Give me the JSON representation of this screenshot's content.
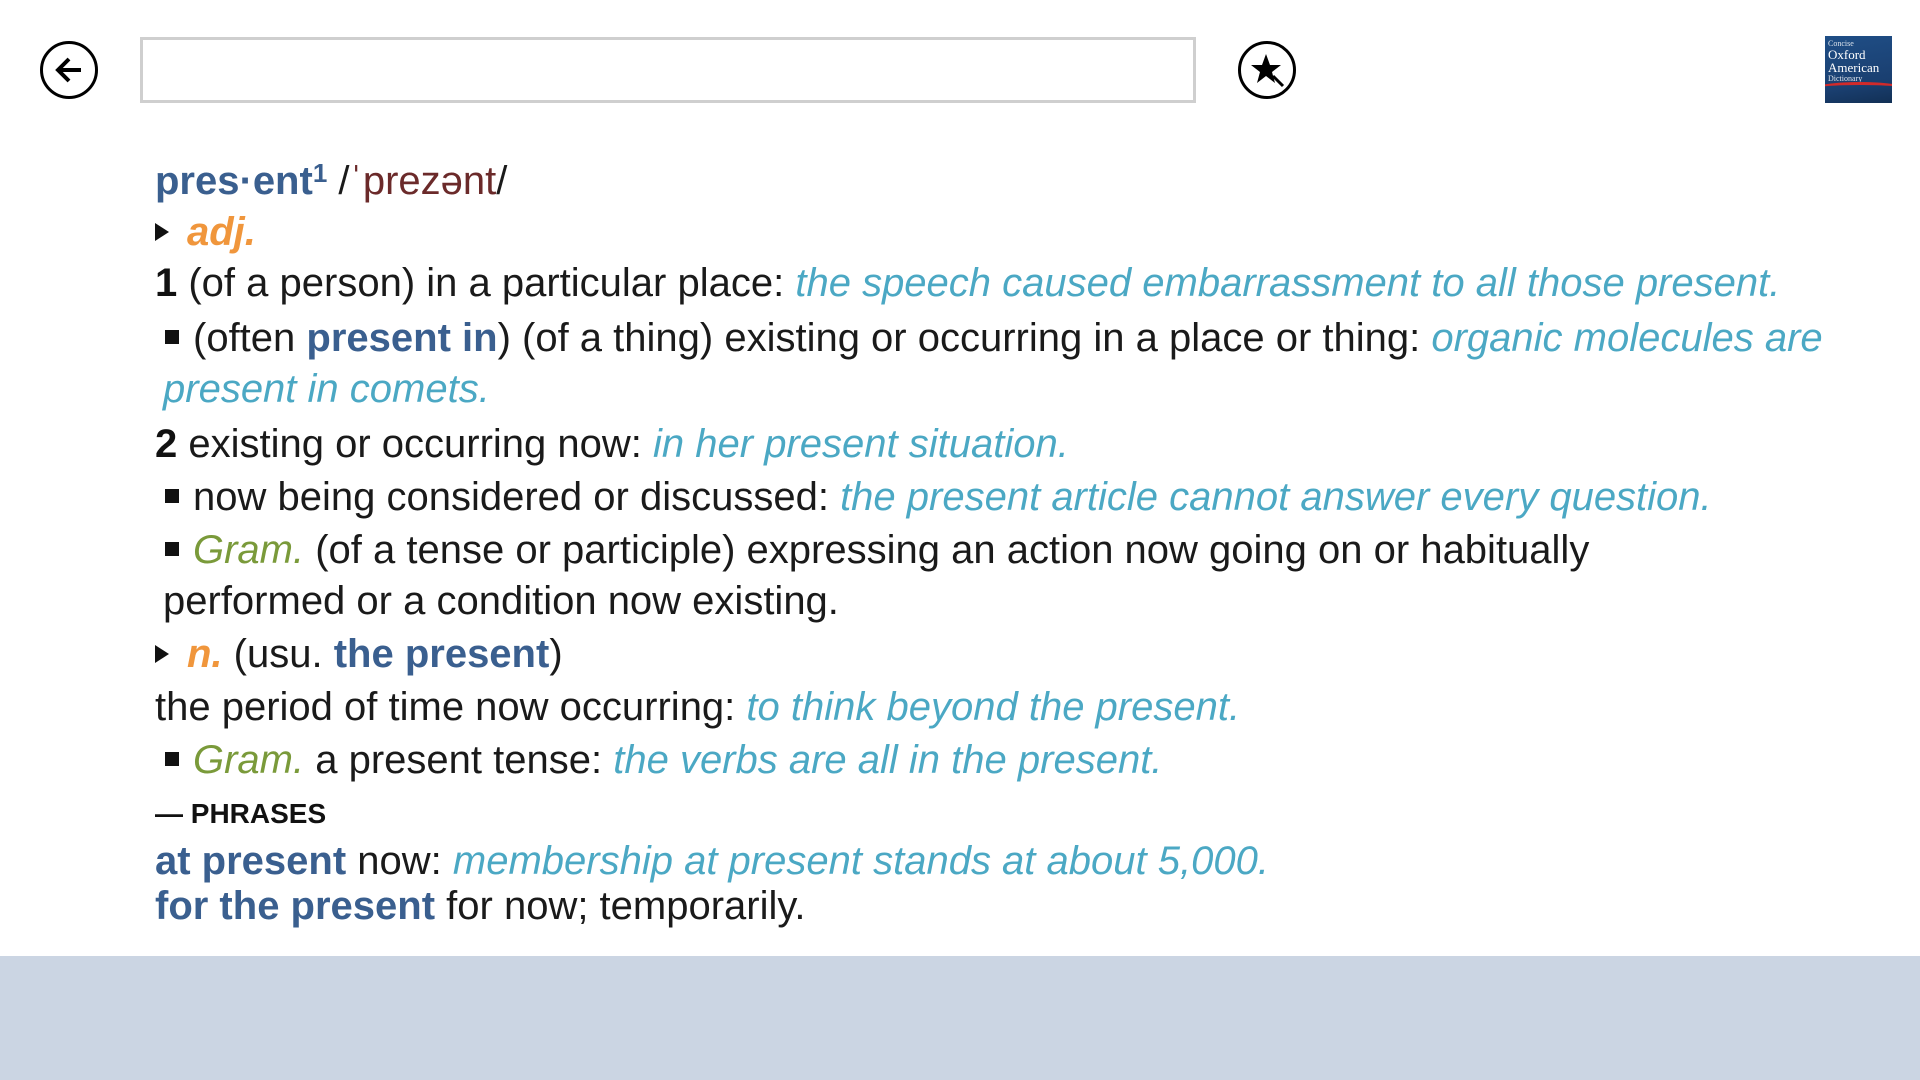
{
  "search": {
    "value": "",
    "placeholder": ""
  },
  "icons": {
    "back": "back-arrow-icon",
    "favorite": "star-pin-icon"
  },
  "logo": {
    "line1": "Concise",
    "line2": "Oxford",
    "line3": "American",
    "line4": "Dictionary"
  },
  "entry": {
    "headword": "pres·ent",
    "homograph": "1",
    "pron_open": " /",
    "pronunciation": "ˈprezənt",
    "pron_close": "/",
    "adj": {
      "pos": "adj.",
      "sense1_num": "1",
      "sense1_def": " (of a person) in a particular place: ",
      "sense1_ex": "the speech caused embarrassment to all those present.",
      "sub1_pre": "(often ",
      "sub1_bold": "present in",
      "sub1_def": ") (of a thing) existing or occurring in a place or thing: ",
      "sub1_ex": "organic molecules are present in comets.",
      "sense2_num": "2",
      "sense2_def": " existing or occurring now: ",
      "sense2_ex": "in her present situation.",
      "sub2_def": "now being considered or discussed: ",
      "sub2_ex": "the present article cannot answer every question.",
      "sub3_gram": "Gram.",
      "sub3_def": " (of a tense or participle) expressing an action now going on or habitually performed or a condition now existing."
    },
    "noun": {
      "pos": "n.",
      "paren_open": " (usu. ",
      "usage": "the present",
      "paren_close": ")",
      "def": "the period of time now occurring: ",
      "ex": "to think beyond the present.",
      "sub_gram": "Gram.",
      "sub_def": " a present tense: ",
      "sub_ex": "the verbs are all in the present."
    },
    "phrases_label": "— PHRASES",
    "phrases": [
      {
        "term": "at present",
        "def": " now: ",
        "ex": "membership at present stands at about 5,000."
      },
      {
        "term": "for the present",
        "def": " for now; temporarily.",
        "ex": ""
      }
    ]
  },
  "colors": {
    "headword": "#3a5f8f",
    "pos": "#f0963c",
    "example": "#4ba8c4",
    "gram": "#7a9a3a",
    "pronunciation": "#6b2a2a",
    "bottom_bar": "#cbd5e3"
  }
}
